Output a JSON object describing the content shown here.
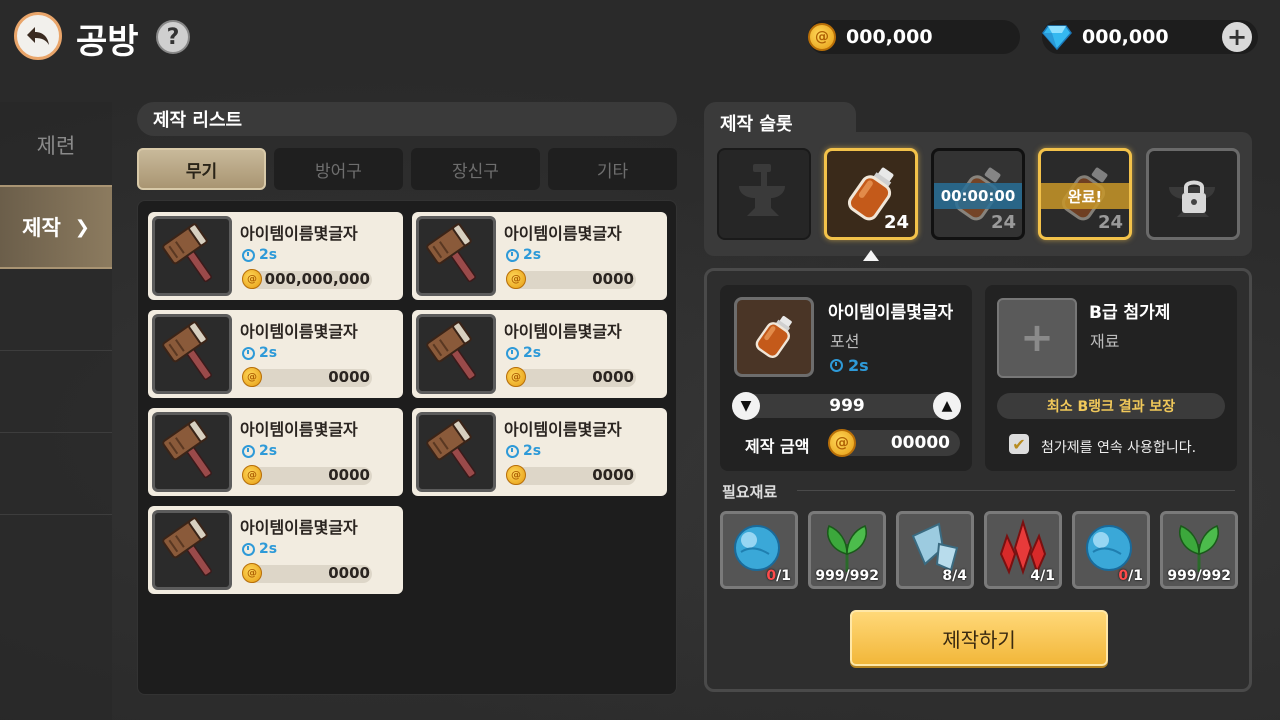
{
  "header": {
    "title": "공방",
    "help": "?",
    "gold": "000,000",
    "gems": "000,000",
    "back_icon": "back-arrow-icon",
    "plus": "+"
  },
  "sidebar": {
    "items": [
      {
        "label": "제련",
        "active": false
      },
      {
        "label": "제작",
        "active": true
      }
    ]
  },
  "list": {
    "title": "제작 리스트",
    "tabs": [
      {
        "label": "무기",
        "active": true
      },
      {
        "label": "방어구",
        "active": false
      },
      {
        "label": "장신구",
        "active": false
      },
      {
        "label": "기타",
        "active": false
      }
    ],
    "items": [
      {
        "name": "아이템이름몇글자",
        "time": "2s",
        "price": "000,000,000"
      },
      {
        "name": "아이템이름몇글자",
        "time": "2s",
        "price": "0000"
      },
      {
        "name": "아이템이름몇글자",
        "time": "2s",
        "price": "0000"
      },
      {
        "name": "아이템이름몇글자",
        "time": "2s",
        "price": "0000"
      },
      {
        "name": "아이템이름몇글자",
        "time": "2s",
        "price": "0000"
      },
      {
        "name": "아이템이름몇글자",
        "time": "2s",
        "price": "0000"
      },
      {
        "name": "아이템이름몇글자",
        "time": "2s",
        "price": "0000"
      }
    ]
  },
  "slots": {
    "title": "제작 슬롯",
    "items": [
      {
        "state": "empty",
        "icon": "anvil-icon"
      },
      {
        "state": "selected",
        "count": "24",
        "icon": "potion-icon"
      },
      {
        "state": "in-progress",
        "count": "24",
        "timer": "00:00:00"
      },
      {
        "state": "complete",
        "count": "24",
        "label": "완료!"
      },
      {
        "state": "locked",
        "icon": "lock-icon"
      }
    ]
  },
  "detail": {
    "item_name": "아이템이름몇글자",
    "item_type": "포션",
    "time": "2s",
    "quantity": "999",
    "cost_label": "제작 금액",
    "cost": "00000",
    "additive_title": "B급 첨가제",
    "additive_sub": "재료",
    "guarantee": "최소 B랭크 결과 보장",
    "auto_use": "첨가제를 연속 사용합니다.",
    "auto_use_checked": true,
    "materials_label": "필요재료",
    "materials": [
      {
        "icon": "blue-orb-icon",
        "have": "0",
        "need": "/1",
        "lacking": true
      },
      {
        "icon": "herb-leaf-icon",
        "have": "999",
        "need": "/992",
        "lacking": false
      },
      {
        "icon": "crystal-shard-icon",
        "have": "8",
        "need": "/4",
        "lacking": false
      },
      {
        "icon": "red-crystal-icon",
        "have": "4",
        "need": "/1",
        "lacking": false
      },
      {
        "icon": "blue-orb-icon",
        "have": "0",
        "need": "/1",
        "lacking": true
      },
      {
        "icon": "herb-leaf-icon",
        "have": "999",
        "need": "/992",
        "lacking": false
      }
    ],
    "craft_button": "제작하기"
  }
}
